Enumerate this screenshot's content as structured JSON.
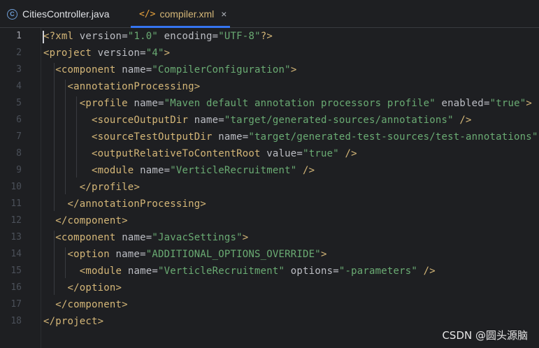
{
  "tabs": [
    {
      "label": "CitiesController.java",
      "icon": "class-icon"
    },
    {
      "label": "compiler.xml",
      "icon": "xml-icon",
      "active": true
    }
  ],
  "close_glyph": "×",
  "line_numbers": [
    "1",
    "2",
    "3",
    "4",
    "5",
    "6",
    "7",
    "8",
    "9",
    "10",
    "11",
    "12",
    "13",
    "14",
    "15",
    "16",
    "17",
    "18"
  ],
  "code": [
    [
      {
        "c": "t",
        "s": "<?xml "
      },
      {
        "c": "a",
        "s": "version"
      },
      {
        "c": "a",
        "s": "="
      },
      {
        "c": "v",
        "s": "\"1.0\""
      },
      {
        "c": "a",
        "s": " encoding"
      },
      {
        "c": "a",
        "s": "="
      },
      {
        "c": "v",
        "s": "\"UTF-8\""
      },
      {
        "c": "t",
        "s": "?>"
      }
    ],
    [
      {
        "c": "t",
        "s": "<project "
      },
      {
        "c": "a",
        "s": "version"
      },
      {
        "c": "a",
        "s": "="
      },
      {
        "c": "v",
        "s": "\"4\""
      },
      {
        "c": "t",
        "s": ">"
      }
    ],
    [
      {
        "c": "a",
        "s": "  "
      },
      {
        "c": "t",
        "s": "<component "
      },
      {
        "c": "a",
        "s": "name"
      },
      {
        "c": "a",
        "s": "="
      },
      {
        "c": "v",
        "s": "\"CompilerConfiguration\""
      },
      {
        "c": "t",
        "s": ">"
      }
    ],
    [
      {
        "c": "a",
        "s": "    "
      },
      {
        "c": "t",
        "s": "<annotationProcessing>"
      }
    ],
    [
      {
        "c": "a",
        "s": "      "
      },
      {
        "c": "t",
        "s": "<profile "
      },
      {
        "c": "a",
        "s": "name"
      },
      {
        "c": "a",
        "s": "="
      },
      {
        "c": "v",
        "s": "\"Maven default annotation processors profile\""
      },
      {
        "c": "a",
        "s": " enabled"
      },
      {
        "c": "a",
        "s": "="
      },
      {
        "c": "v",
        "s": "\"true\""
      },
      {
        "c": "t",
        "s": ">"
      }
    ],
    [
      {
        "c": "a",
        "s": "        "
      },
      {
        "c": "t",
        "s": "<sourceOutputDir "
      },
      {
        "c": "a",
        "s": "name"
      },
      {
        "c": "a",
        "s": "="
      },
      {
        "c": "v",
        "s": "\"target/generated-sources/annotations\""
      },
      {
        "c": "t",
        "s": " />"
      }
    ],
    [
      {
        "c": "a",
        "s": "        "
      },
      {
        "c": "t",
        "s": "<sourceTestOutputDir "
      },
      {
        "c": "a",
        "s": "name"
      },
      {
        "c": "a",
        "s": "="
      },
      {
        "c": "v",
        "s": "\"target/generated-test-sources/test-annotations\""
      },
      {
        "c": "t",
        "s": " />"
      }
    ],
    [
      {
        "c": "a",
        "s": "        "
      },
      {
        "c": "t",
        "s": "<outputRelativeToContentRoot "
      },
      {
        "c": "a",
        "s": "value"
      },
      {
        "c": "a",
        "s": "="
      },
      {
        "c": "v",
        "s": "\"true\""
      },
      {
        "c": "t",
        "s": " />"
      }
    ],
    [
      {
        "c": "a",
        "s": "        "
      },
      {
        "c": "t",
        "s": "<module "
      },
      {
        "c": "a",
        "s": "name"
      },
      {
        "c": "a",
        "s": "="
      },
      {
        "c": "v",
        "s": "\"VerticleRecruitment\""
      },
      {
        "c": "t",
        "s": " />"
      }
    ],
    [
      {
        "c": "a",
        "s": "      "
      },
      {
        "c": "t",
        "s": "</profile>"
      }
    ],
    [
      {
        "c": "a",
        "s": "    "
      },
      {
        "c": "t",
        "s": "</annotationProcessing>"
      }
    ],
    [
      {
        "c": "a",
        "s": "  "
      },
      {
        "c": "t",
        "s": "</component>"
      }
    ],
    [
      {
        "c": "a",
        "s": "  "
      },
      {
        "c": "t",
        "s": "<component "
      },
      {
        "c": "a",
        "s": "name"
      },
      {
        "c": "a",
        "s": "="
      },
      {
        "c": "v",
        "s": "\"JavacSettings\""
      },
      {
        "c": "t",
        "s": ">"
      }
    ],
    [
      {
        "c": "a",
        "s": "    "
      },
      {
        "c": "t",
        "s": "<option "
      },
      {
        "c": "a",
        "s": "name"
      },
      {
        "c": "a",
        "s": "="
      },
      {
        "c": "v",
        "s": "\"ADDITIONAL_OPTIONS_OVERRIDE\""
      },
      {
        "c": "t",
        "s": ">"
      }
    ],
    [
      {
        "c": "a",
        "s": "      "
      },
      {
        "c": "t",
        "s": "<module "
      },
      {
        "c": "a",
        "s": "name"
      },
      {
        "c": "a",
        "s": "="
      },
      {
        "c": "v",
        "s": "\"VerticleRecruitment\""
      },
      {
        "c": "a",
        "s": " options"
      },
      {
        "c": "a",
        "s": "="
      },
      {
        "c": "v",
        "s": "\"-parameters\""
      },
      {
        "c": "t",
        "s": " />"
      }
    ],
    [
      {
        "c": "a",
        "s": "    "
      },
      {
        "c": "t",
        "s": "</option>"
      }
    ],
    [
      {
        "c": "a",
        "s": "  "
      },
      {
        "c": "t",
        "s": "</component>"
      }
    ],
    [
      {
        "c": "t",
        "s": "</project>"
      }
    ]
  ],
  "active_line": 1,
  "watermark": "CSDN @圆头源脑",
  "colors": {
    "tag": "#d5b778",
    "attr": "#bcbec4",
    "string": "#6aab73",
    "accent": "#3574f0",
    "background": "#1e1f22"
  }
}
